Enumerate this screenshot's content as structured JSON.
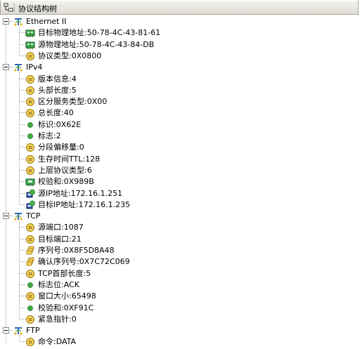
{
  "panel": {
    "title": "协议结构树"
  },
  "tree": [
    {
      "label": "Ethernet II",
      "expanded": true,
      "icon": "protocol-node-icon",
      "children": [
        {
          "label": "目标物理地址:50-78-4C-43-81-61",
          "icon": "mac-address-icon"
        },
        {
          "label": "源物理地址:50-78-4C-43-84-DB",
          "icon": "mac-address-icon"
        },
        {
          "label": "协议类型:0X0800",
          "icon": "field-icon"
        }
      ]
    },
    {
      "label": "IPv4",
      "expanded": true,
      "icon": "protocol-node-icon",
      "children": [
        {
          "label": "版本信息:4",
          "icon": "field-icon"
        },
        {
          "label": "头部长度:5",
          "icon": "field-icon"
        },
        {
          "label": "区分服务类型:0X00",
          "icon": "field-icon"
        },
        {
          "label": "总长度:40",
          "icon": "field-icon"
        },
        {
          "label": "标识:0X62E",
          "icon": "flag-dot-icon"
        },
        {
          "label": "标志:2",
          "icon": "flag-dot-icon"
        },
        {
          "label": "分段偏移量:0",
          "icon": "field-icon"
        },
        {
          "label": "生存时间TTL:128",
          "icon": "field-icon"
        },
        {
          "label": "上层协议类型:6",
          "icon": "field-icon"
        },
        {
          "label": "校验和:0X989B",
          "icon": "checksum-icon"
        },
        {
          "label": "源IP地址:172.16.1.251",
          "icon": "ip-address-icon"
        },
        {
          "label": "目标IP地址:172.16.1.235",
          "icon": "ip-address-icon"
        }
      ]
    },
    {
      "label": "TCP",
      "expanded": true,
      "icon": "protocol-node-icon",
      "children": [
        {
          "label": "源端口:1087",
          "icon": "field-icon"
        },
        {
          "label": "目标端口:21",
          "icon": "field-icon"
        },
        {
          "label": "序列号:0X8F5D8A48",
          "icon": "sequence-icon"
        },
        {
          "label": "确认序列号:0X7C72C069",
          "icon": "sequence-icon"
        },
        {
          "label": "TCP首部长度:5",
          "icon": "field-icon"
        },
        {
          "label": "标志位:ACK",
          "icon": "flag-dot-icon"
        },
        {
          "label": "窗口大小:65498",
          "icon": "field-icon"
        },
        {
          "label": "校验和:0XF91C",
          "icon": "flag-dot-icon"
        },
        {
          "label": "紧急指针:0",
          "icon": "field-icon"
        }
      ]
    },
    {
      "label": "FTP",
      "expanded": true,
      "icon": "protocol-node-icon",
      "children": [
        {
          "label": "命令:DATA",
          "icon": "field-icon"
        }
      ]
    }
  ]
}
